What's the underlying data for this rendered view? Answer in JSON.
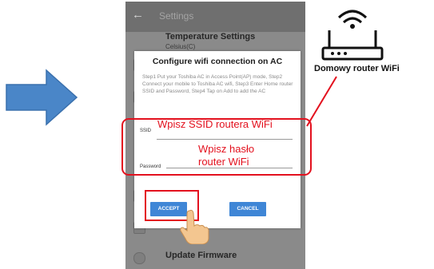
{
  "appbar": {
    "title": "Settings"
  },
  "background": {
    "temp_title": "Temperature Settings",
    "temp_sub": "Celsius(C)",
    "update_label": "Update Firmware"
  },
  "dialog": {
    "title": "Configure wifi connection on AC",
    "instructions": "Step1 Put your Toshiba AC in Access Point(AP) mode, Step2 Connect your mobile to Toshiba AC wifi, Step3 Enter Home router SSID and Password, Step4 Tap on Add to add the AC",
    "ssid_label": "SSID",
    "ssid_hint": "Wpisz SSID routera WiFi",
    "password_label": "Password",
    "password_hint": "Wpisz hasło router WiFi",
    "accept_label": "ACCEPT",
    "cancel_label": "CANCEL"
  },
  "router": {
    "label": "Domowy router WiFi"
  },
  "colors": {
    "annotation_red": "#e3111e",
    "button_blue": "#3f86d6",
    "arrow_blue": "#4a86c8"
  },
  "icons": {
    "arrow": "right-arrow-icon",
    "router": "wifi-router-icon",
    "hand": "pointing-hand-icon",
    "back": "back-arrow-icon"
  }
}
